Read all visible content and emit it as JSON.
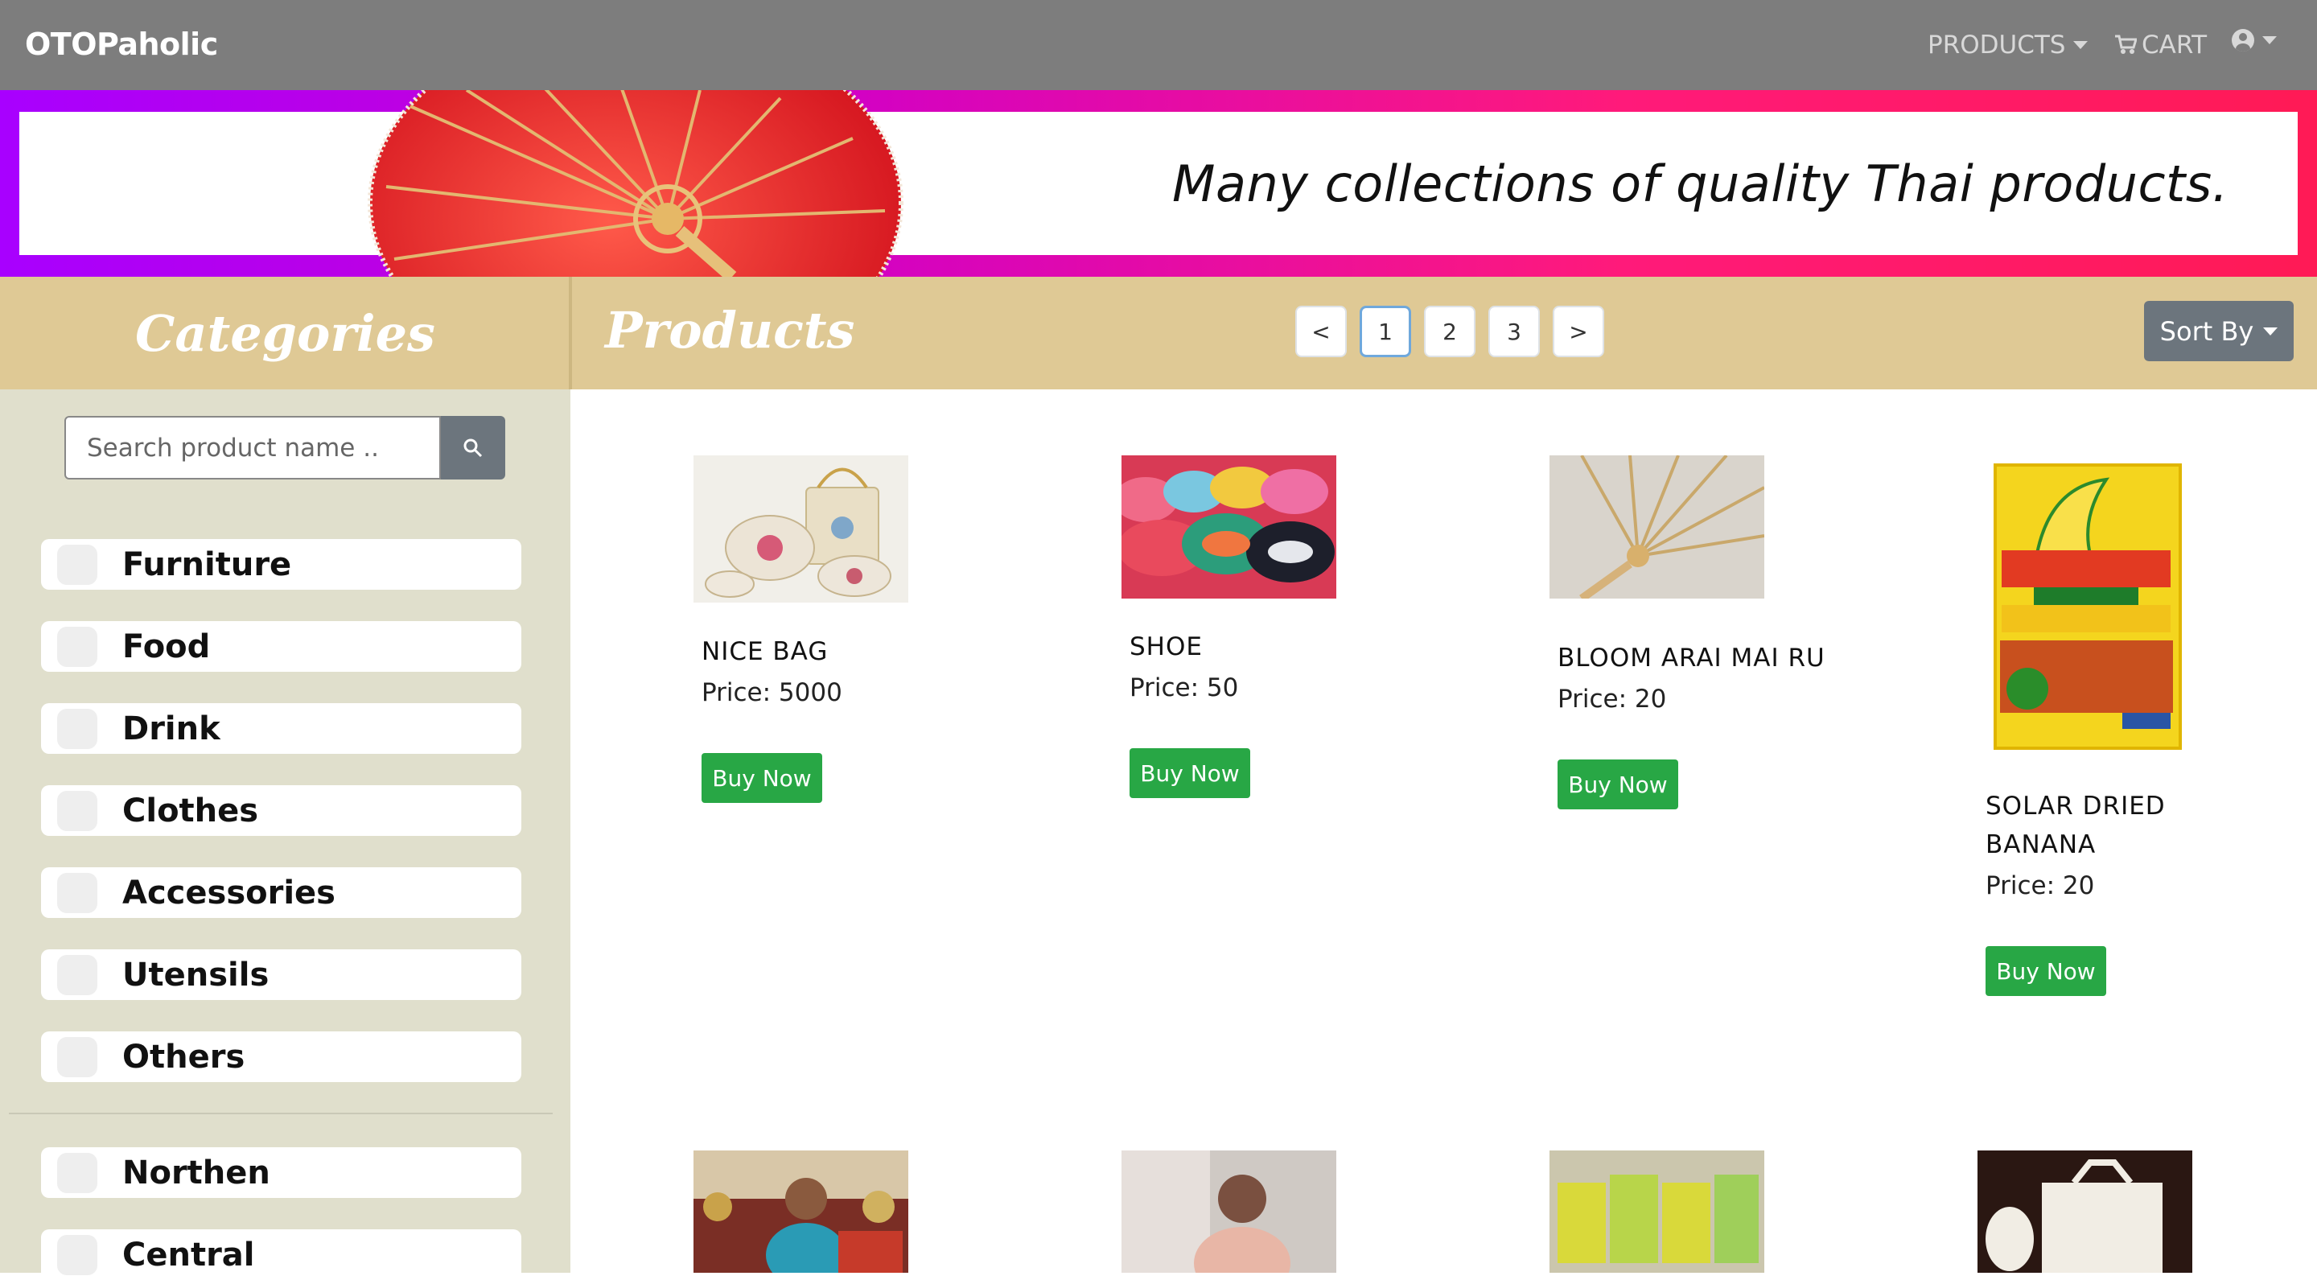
{
  "navbar": {
    "brand": "OTOPaholic",
    "products_label": "PRODUCTS",
    "cart_label": "CART"
  },
  "banner": {
    "tagline": "Many collections of quality Thai products."
  },
  "headers": {
    "categories": "Categories",
    "products": "Products"
  },
  "pagination": {
    "prev": "<",
    "pages": [
      "1",
      "2",
      "3"
    ],
    "next": ">",
    "active_page": "1"
  },
  "sort": {
    "label": "Sort By"
  },
  "search": {
    "placeholder": "Search product name .."
  },
  "categories": [
    "Furniture",
    "Food",
    "Drink",
    "Clothes",
    "Accessories",
    "Utensils",
    "Others"
  ],
  "regions": [
    "Northen",
    "Central"
  ],
  "products": [
    {
      "name": "NICE BAG",
      "price": "Price: 5000",
      "buy": "Buy Now"
    },
    {
      "name": "SHOE",
      "price": "Price: 50",
      "buy": "Buy Now"
    },
    {
      "name": "BLOOM ARAI MAI RU",
      "price": "Price: 20",
      "buy": "Buy Now"
    },
    {
      "name": "SOLAR DRIED BANANA",
      "price": "Price: 20",
      "buy": "Buy Now"
    }
  ],
  "colors": {
    "navbar": "#7d7d7d",
    "header_band": "#dfc995",
    "sidebar": "#e0dfcc",
    "buy_button": "#28a745",
    "sort_button": "#6c757d"
  }
}
